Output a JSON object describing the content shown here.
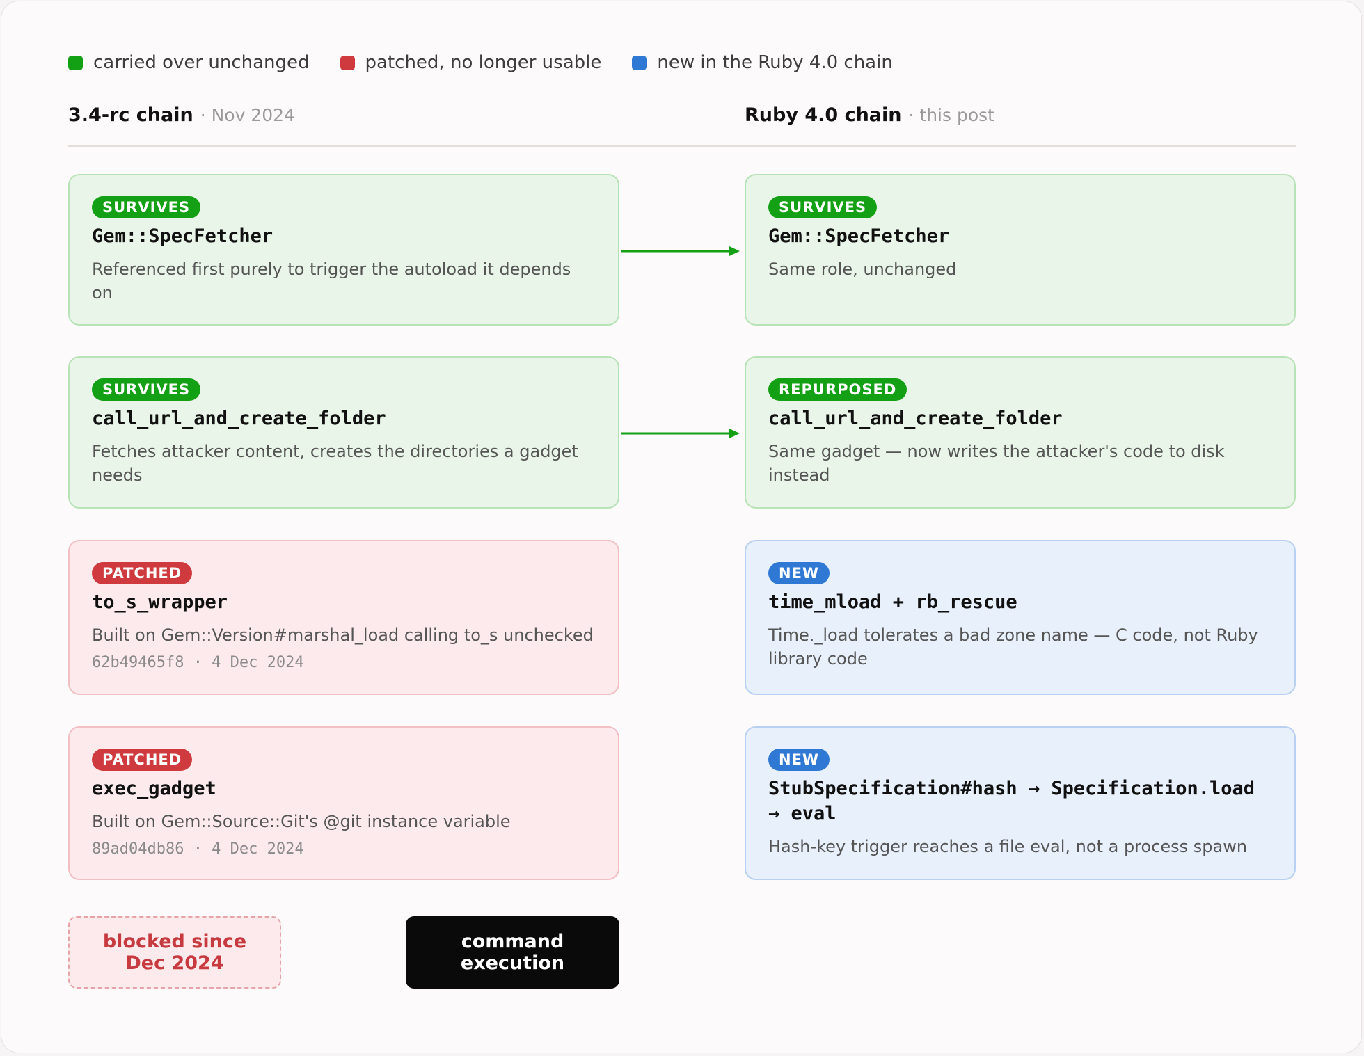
{
  "legend": [
    {
      "label": "carried over unchanged",
      "color": "#14a014"
    },
    {
      "label": "patched, no longer usable",
      "color": "#cf3a3e"
    },
    {
      "label": "new in the Ruby 4.0 chain",
      "color": "#2f78d4"
    }
  ],
  "columns": {
    "left": {
      "title": "3.4-rc chain",
      "sub": "· Nov 2024"
    },
    "right": {
      "title": "Ruby 4.0 chain",
      "sub": "· this post"
    }
  },
  "cards": {
    "left_1": {
      "badge": "SURVIVES",
      "title": "Gem::SpecFetcher",
      "desc": "Referenced first purely to trigger the autoload it depends on"
    },
    "left_2": {
      "badge": "SURVIVES",
      "title": "call_url_and_create_folder",
      "desc": "Fetches attacker content, creates the directories a gadget needs"
    },
    "left_3": {
      "badge": "PATCHED",
      "title": "to_s_wrapper",
      "desc": "Built on Gem::Version#marshal_load calling to_s unchecked",
      "meta": "62b49465f8 · 4 Dec 2024"
    },
    "left_4": {
      "badge": "PATCHED",
      "title": "exec_gadget",
      "desc": "Built on Gem::Source::Git's @git instance variable",
      "meta": "89ad04db86 · 4 Dec 2024"
    },
    "right_1": {
      "badge": "SURVIVES",
      "title": "Gem::SpecFetcher",
      "desc": "Same role, unchanged"
    },
    "right_2": {
      "badge": "REPURPOSED",
      "title": "call_url_and_create_folder",
      "desc": "Same gadget — now writes the attacker's code to disk instead"
    },
    "right_3": {
      "badge": "NEW",
      "title": "time_mload + rb_rescue",
      "desc": "Time._load tolerates a bad zone name — C code, not Ruby library code"
    },
    "right_4": {
      "badge": "NEW",
      "title": "StubSpecification#hash → Specification.load → eval",
      "desc": "Hash-key trigger reaches a file eval, not a process spawn"
    }
  },
  "blocked": {
    "label": "blocked since Dec 2024"
  },
  "command": {
    "label": "command execution"
  },
  "colors": {
    "green": "#14a014",
    "red": "#cf3a3e",
    "blue": "#2f78d4"
  }
}
